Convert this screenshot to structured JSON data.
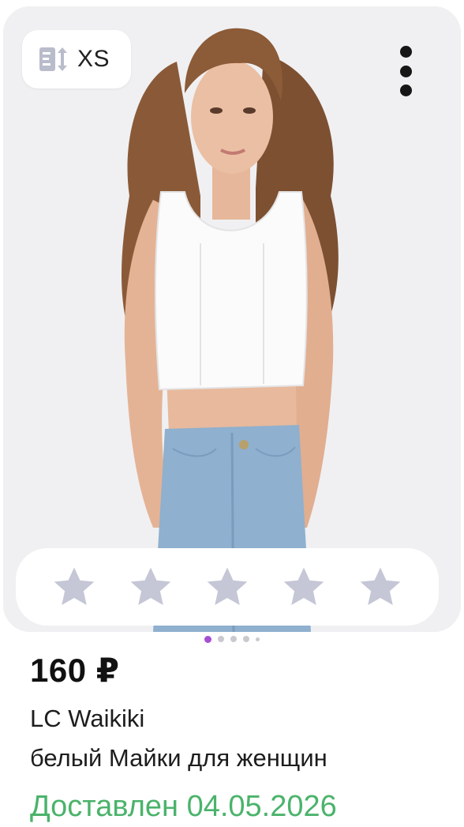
{
  "product": {
    "size_badge": {
      "icon": "size-arrows-icon",
      "label": "XS"
    },
    "menu_icon": "more-vertical-icon",
    "rating": {
      "stars_total": 5,
      "stars_filled": 0,
      "star_color": "#c5c6d6"
    },
    "gallery": {
      "pages": 5,
      "active_index": 0,
      "active_color": "#a64dd6"
    },
    "price": "160 ₽",
    "brand": "LC Waikiki",
    "title": "белый Майки для женщин",
    "delivery_status": "Доставлен 04.05.2026",
    "delivery_color": "#4bb36b"
  }
}
